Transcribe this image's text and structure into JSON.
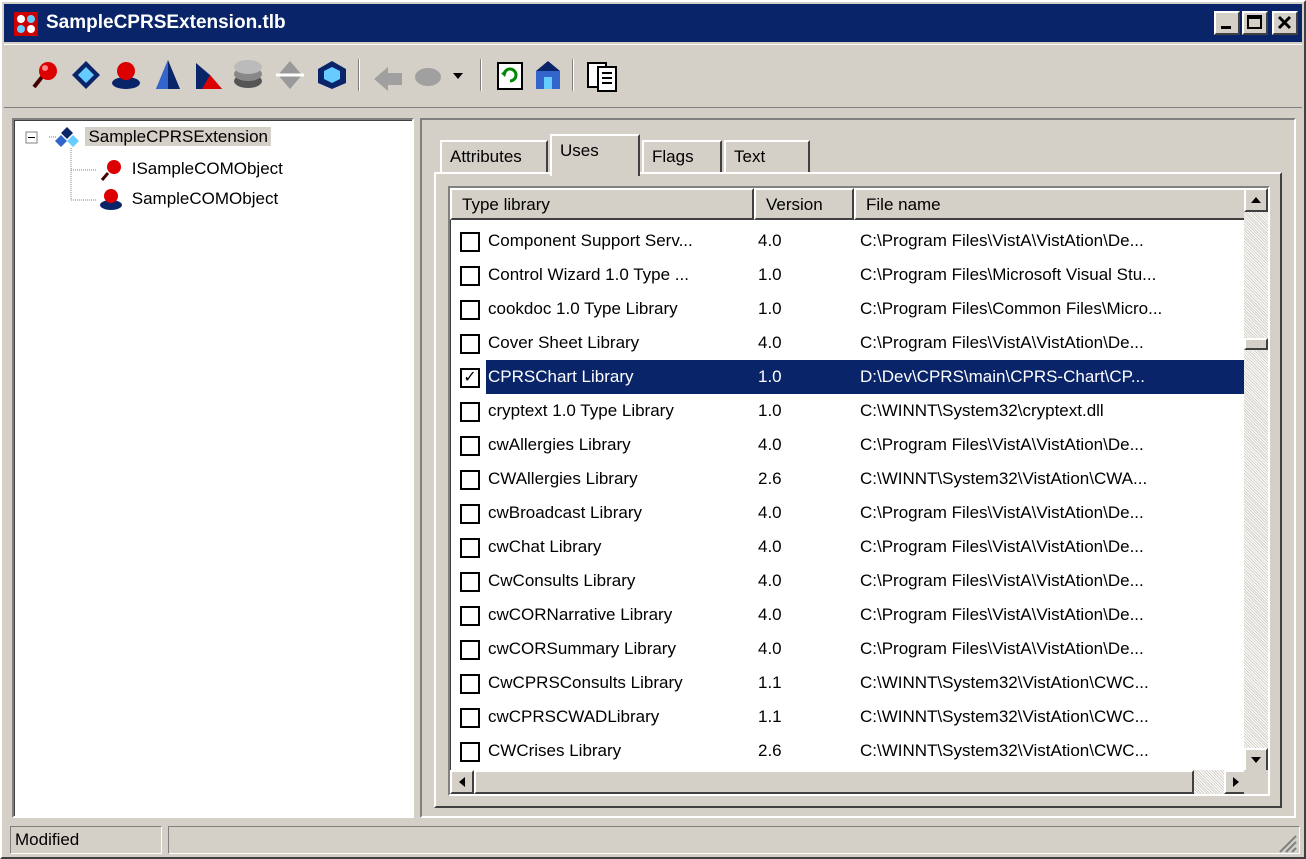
{
  "window": {
    "title": "SampleCPRSExtension.tlb"
  },
  "title_buttons": [
    "minimize",
    "maximize",
    "close"
  ],
  "toolbar": {
    "icons": [
      "interface-icon",
      "dispinterface-icon",
      "coclass-icon",
      "module-icon",
      "enum-icon",
      "record-icon",
      "union-icon",
      "alias-icon",
      "method-icon",
      "property-dropdown-icon",
      "refresh-icon",
      "register-icon",
      "export-icon"
    ]
  },
  "tree": {
    "root": "SampleCPRSExtension",
    "children": [
      "ISampleCOMObject",
      "SampleCOMObject"
    ]
  },
  "tabs": [
    "Attributes",
    "Uses",
    "Flags",
    "Text"
  ],
  "active_tab": "Uses",
  "columns": [
    "Type library",
    "Version",
    "File name"
  ],
  "rows": [
    {
      "checked": false,
      "name": "Component Support Serv...",
      "version": "4.0",
      "file": "C:\\Program Files\\VistA\\VistAtion\\De..."
    },
    {
      "checked": false,
      "name": "Control Wizard 1.0 Type ...",
      "version": "1.0",
      "file": "C:\\Program Files\\Microsoft Visual Stu..."
    },
    {
      "checked": false,
      "name": "cookdoc 1.0 Type Library",
      "version": "1.0",
      "file": "C:\\Program Files\\Common Files\\Micro..."
    },
    {
      "checked": false,
      "name": "Cover Sheet Library",
      "version": "4.0",
      "file": "C:\\Program Files\\VistA\\VistAtion\\De..."
    },
    {
      "checked": true,
      "name": "CPRSChart Library",
      "version": "1.0",
      "file": "D:\\Dev\\CPRS\\main\\CPRS-Chart\\CP..."
    },
    {
      "checked": false,
      "name": "cryptext 1.0 Type Library",
      "version": "1.0",
      "file": "C:\\WINNT\\System32\\cryptext.dll"
    },
    {
      "checked": false,
      "name": "cwAllergies Library",
      "version": "4.0",
      "file": "C:\\Program Files\\VistA\\VistAtion\\De..."
    },
    {
      "checked": false,
      "name": "CWAllergies Library",
      "version": "2.6",
      "file": "C:\\WINNT\\System32\\VistAtion\\CWA..."
    },
    {
      "checked": false,
      "name": "cwBroadcast Library",
      "version": "4.0",
      "file": "C:\\Program Files\\VistA\\VistAtion\\De..."
    },
    {
      "checked": false,
      "name": "cwChat Library",
      "version": "4.0",
      "file": "C:\\Program Files\\VistA\\VistAtion\\De..."
    },
    {
      "checked": false,
      "name": "CwConsults Library",
      "version": "4.0",
      "file": "C:\\Program Files\\VistA\\VistAtion\\De..."
    },
    {
      "checked": false,
      "name": "cwCORNarrative Library",
      "version": "4.0",
      "file": "C:\\Program Files\\VistA\\VistAtion\\De..."
    },
    {
      "checked": false,
      "name": "cwCORSummary Library",
      "version": "4.0",
      "file": "C:\\Program Files\\VistA\\VistAtion\\De..."
    },
    {
      "checked": false,
      "name": "CwCPRSConsults Library",
      "version": "1.1",
      "file": "C:\\WINNT\\System32\\VistAtion\\CWC..."
    },
    {
      "checked": false,
      "name": "cwCPRSCWADLibrary",
      "version": "1.1",
      "file": "C:\\WINNT\\System32\\VistAtion\\CWC..."
    },
    {
      "checked": false,
      "name": "CWCrises Library",
      "version": "2.6",
      "file": "C:\\WINNT\\System32\\VistAtion\\CWC..."
    }
  ],
  "selected_row": 4,
  "status": {
    "text": "Modified"
  },
  "colors": {
    "titlebar": "#0a246a",
    "selection": "#0a246a",
    "face": "#d4d0c8"
  }
}
